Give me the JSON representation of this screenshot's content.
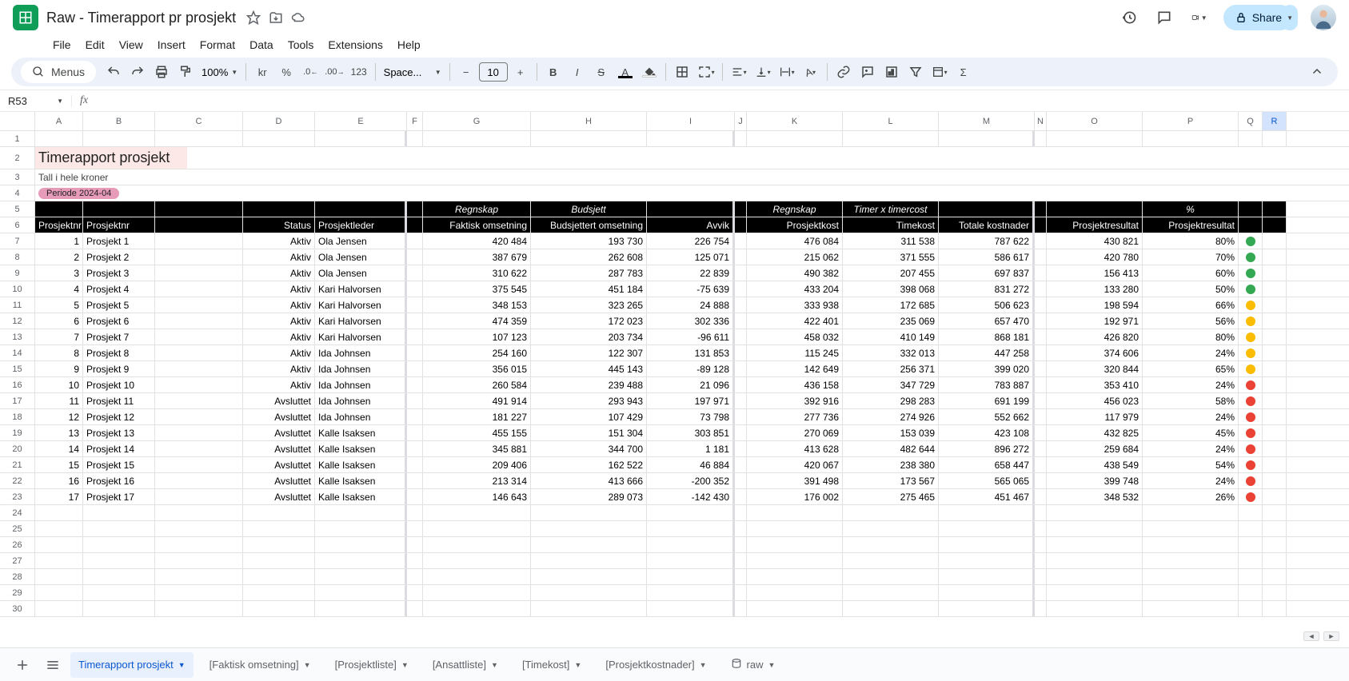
{
  "doc": {
    "title": "Raw - Timerapport pr prosjekt"
  },
  "menus": [
    "File",
    "Edit",
    "View",
    "Insert",
    "Format",
    "Data",
    "Tools",
    "Extensions",
    "Help"
  ],
  "toolbar": {
    "menus_label": "Menus",
    "zoom": "100%",
    "currency": "kr",
    "percent": "%",
    "font": "Space...",
    "fontsize": "10",
    "share": "Share"
  },
  "fx": {
    "cellref": "R53"
  },
  "report": {
    "title": "Timerapport prosjekt",
    "subtitle": "Tall i hele kroner",
    "period": "Periode 2024-04"
  },
  "super_headers": {
    "G": "Regnskap",
    "H": "Budsjett",
    "K": "Regnskap",
    "L": "Timer x timercost",
    "P": "%"
  },
  "headers": {
    "A": "Prosjektnr",
    "B": "Prosjektnr",
    "D": "Status",
    "E": "Prosjektleder",
    "G": "Faktisk omsetning",
    "H": "Budsjettert omsetning",
    "I": "Avvik",
    "K": "Prosjektkost",
    "L": "Timekost",
    "M": "Totale kostnader",
    "O": "Prosjektresultat",
    "P": "Prosjektresultat"
  },
  "rows": [
    {
      "nr": "1",
      "navn": "Prosjekt 1",
      "status": "Aktiv",
      "leder": "Ola Jensen",
      "g": "420 484",
      "h": "193 730",
      "i": "226 754",
      "k": "476 084",
      "l": "311 538",
      "m": "787 622",
      "o": "430 821",
      "p": "80%",
      "dot": "g"
    },
    {
      "nr": "2",
      "navn": "Prosjekt 2",
      "status": "Aktiv",
      "leder": "Ola Jensen",
      "g": "387 679",
      "h": "262 608",
      "i": "125 071",
      "k": "215 062",
      "l": "371 555",
      "m": "586 617",
      "o": "420 780",
      "p": "70%",
      "dot": "g"
    },
    {
      "nr": "3",
      "navn": "Prosjekt 3",
      "status": "Aktiv",
      "leder": "Ola Jensen",
      "g": "310 622",
      "h": "287 783",
      "i": "22 839",
      "k": "490 382",
      "l": "207 455",
      "m": "697 837",
      "o": "156 413",
      "p": "60%",
      "dot": "g"
    },
    {
      "nr": "4",
      "navn": "Prosjekt 4",
      "status": "Aktiv",
      "leder": "Kari Halvorsen",
      "g": "375 545",
      "h": "451 184",
      "i": "-75 639",
      "k": "433 204",
      "l": "398 068",
      "m": "831 272",
      "o": "133 280",
      "p": "50%",
      "dot": "g"
    },
    {
      "nr": "5",
      "navn": "Prosjekt 5",
      "status": "Aktiv",
      "leder": "Kari Halvorsen",
      "g": "348 153",
      "h": "323 265",
      "i": "24 888",
      "k": "333 938",
      "l": "172 685",
      "m": "506 623",
      "o": "198 594",
      "p": "66%",
      "dot": "y"
    },
    {
      "nr": "6",
      "navn": "Prosjekt 6",
      "status": "Aktiv",
      "leder": "Kari Halvorsen",
      "g": "474 359",
      "h": "172 023",
      "i": "302 336",
      "k": "422 401",
      "l": "235 069",
      "m": "657 470",
      "o": "192 971",
      "p": "56%",
      "dot": "y"
    },
    {
      "nr": "7",
      "navn": "Prosjekt 7",
      "status": "Aktiv",
      "leder": "Kari Halvorsen",
      "g": "107 123",
      "h": "203 734",
      "i": "-96 611",
      "k": "458 032",
      "l": "410 149",
      "m": "868 181",
      "o": "426 820",
      "p": "80%",
      "dot": "y"
    },
    {
      "nr": "8",
      "navn": "Prosjekt 8",
      "status": "Aktiv",
      "leder": "Ida Johnsen",
      "g": "254 160",
      "h": "122 307",
      "i": "131 853",
      "k": "115 245",
      "l": "332 013",
      "m": "447 258",
      "o": "374 606",
      "p": "24%",
      "dot": "y"
    },
    {
      "nr": "9",
      "navn": "Prosjekt 9",
      "status": "Aktiv",
      "leder": "Ida Johnsen",
      "g": "356 015",
      "h": "445 143",
      "i": "-89 128",
      "k": "142 649",
      "l": "256 371",
      "m": "399 020",
      "o": "320 844",
      "p": "65%",
      "dot": "y"
    },
    {
      "nr": "10",
      "navn": "Prosjekt 10",
      "status": "Aktiv",
      "leder": "Ida Johnsen",
      "g": "260 584",
      "h": "239 488",
      "i": "21 096",
      "k": "436 158",
      "l": "347 729",
      "m": "783 887",
      "o": "353 410",
      "p": "24%",
      "dot": "r"
    },
    {
      "nr": "11",
      "navn": "Prosjekt 11",
      "status": "Avsluttet",
      "leder": "Ida Johnsen",
      "g": "491 914",
      "h": "293 943",
      "i": "197 971",
      "k": "392 916",
      "l": "298 283",
      "m": "691 199",
      "o": "456 023",
      "p": "58%",
      "dot": "r"
    },
    {
      "nr": "12",
      "navn": "Prosjekt 12",
      "status": "Avsluttet",
      "leder": "Ida Johnsen",
      "g": "181 227",
      "h": "107 429",
      "i": "73 798",
      "k": "277 736",
      "l": "274 926",
      "m": "552 662",
      "o": "117 979",
      "p": "24%",
      "dot": "r"
    },
    {
      "nr": "13",
      "navn": "Prosjekt 13",
      "status": "Avsluttet",
      "leder": "Kalle Isaksen",
      "g": "455 155",
      "h": "151 304",
      "i": "303 851",
      "k": "270 069",
      "l": "153 039",
      "m": "423 108",
      "o": "432 825",
      "p": "45%",
      "dot": "r"
    },
    {
      "nr": "14",
      "navn": "Prosjekt 14",
      "status": "Avsluttet",
      "leder": "Kalle Isaksen",
      "g": "345 881",
      "h": "344 700",
      "i": "1 181",
      "k": "413 628",
      "l": "482 644",
      "m": "896 272",
      "o": "259 684",
      "p": "24%",
      "dot": "r"
    },
    {
      "nr": "15",
      "navn": "Prosjekt 15",
      "status": "Avsluttet",
      "leder": "Kalle Isaksen",
      "g": "209 406",
      "h": "162 522",
      "i": "46 884",
      "k": "420 067",
      "l": "238 380",
      "m": "658 447",
      "o": "438 549",
      "p": "54%",
      "dot": "r"
    },
    {
      "nr": "16",
      "navn": "Prosjekt 16",
      "status": "Avsluttet",
      "leder": "Kalle Isaksen",
      "g": "213 314",
      "h": "413 666",
      "i": "-200 352",
      "k": "391 498",
      "l": "173 567",
      "m": "565 065",
      "o": "399 748",
      "p": "24%",
      "dot": "r"
    },
    {
      "nr": "17",
      "navn": "Prosjekt 17",
      "status": "Avsluttet",
      "leder": "Kalle Isaksen",
      "g": "146 643",
      "h": "289 073",
      "i": "-142 430",
      "k": "176 002",
      "l": "275 465",
      "m": "451 467",
      "o": "348 532",
      "p": "26%",
      "dot": "r"
    }
  ],
  "tabs": [
    {
      "label": "Timerapport prosjekt",
      "active": true,
      "type": "sheet"
    },
    {
      "label": "[Faktisk omsetning]",
      "type": "sheet"
    },
    {
      "label": "[Prosjektliste]",
      "type": "sheet"
    },
    {
      "label": "[Ansattliste]",
      "type": "sheet"
    },
    {
      "label": "[Timekost]",
      "type": "sheet"
    },
    {
      "label": "[Prosjektkostnader]",
      "type": "sheet"
    },
    {
      "label": "raw",
      "type": "data"
    }
  ]
}
